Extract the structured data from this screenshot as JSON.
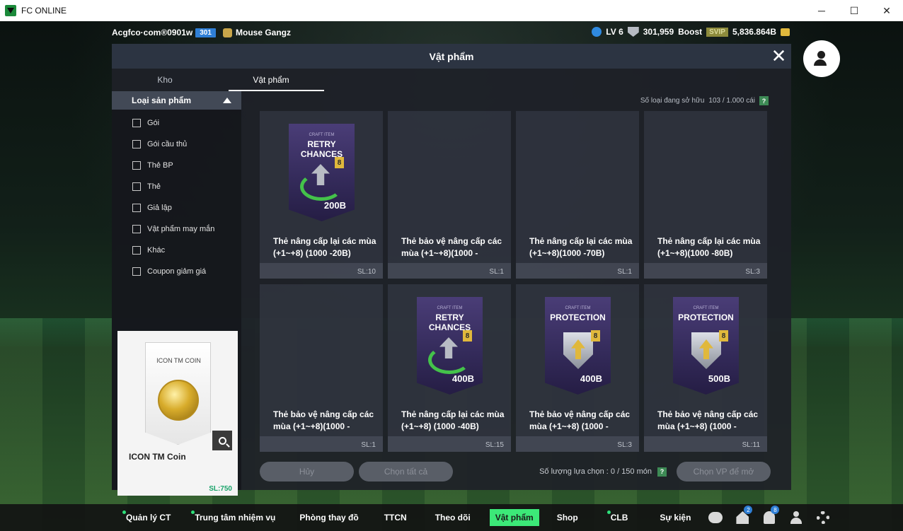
{
  "window": {
    "title": "FC ONLINE",
    "controls": [
      "─",
      "☐",
      "✕"
    ]
  },
  "topbar": {
    "account": "Acgfco·com®0901w",
    "account_badge": "301",
    "club": "Mouse Gangz",
    "level": "LV 6",
    "points": "301,959",
    "boost": "Boost",
    "svip": "SVIP",
    "bp": "5,836.864B"
  },
  "modal": {
    "title": "Vật phẩm",
    "close_icon": "✕",
    "tabs": [
      {
        "label": "Kho"
      },
      {
        "label": "Vật phẩm"
      }
    ],
    "filter": {
      "header": "Loại sản phẩm",
      "items": [
        {
          "label": "Gói"
        },
        {
          "label": "Gói cầu thủ"
        },
        {
          "label": "Thẻ BP"
        },
        {
          "label": "Thẻ"
        },
        {
          "label": "Giả lập"
        },
        {
          "label": "Vật phẩm may mắn"
        },
        {
          "label": "Khác"
        },
        {
          "label": "Coupon giảm giá"
        }
      ]
    },
    "preview": {
      "card_title": "ICON TM COIN",
      "name": "ICON TM Coin",
      "qty": "SL:750"
    },
    "owned_label": "Số loại đang sở hữu",
    "owned_value": "103 / 1.000 cái",
    "help": "?",
    "items": [
      {
        "name": "Thẻ nâng cấp lại các mùa (+1~+8) (1000 -20B)",
        "qty": "SL:10",
        "card": {
          "type": "retry",
          "craft": "CRAFT ITEM",
          "title": "RETRY CHANCES",
          "badge": "8",
          "price": "200B"
        }
      },
      {
        "name": "Thẻ bảo vệ nâng cấp các mùa (+1~+8)(1000 -",
        "qty": "SL:1"
      },
      {
        "name": "Thẻ nâng cấp lại các mùa (+1~+8)(1000 -70B)",
        "qty": "SL:1"
      },
      {
        "name": "Thẻ nâng cấp lại các mùa (+1~+8)(1000 -80B)",
        "qty": "SL:3"
      },
      {
        "name": "Thẻ bảo vệ nâng cấp các mùa (+1~+8)(1000 -",
        "qty": "SL:1"
      },
      {
        "name": "Thẻ nâng cấp lại các mùa (+1~+8) (1000 -40B)",
        "qty": "SL:15",
        "card": {
          "type": "retry",
          "craft": "CRAFT ITEM",
          "title": "RETRY CHANCES",
          "badge": "8",
          "price": "400B"
        }
      },
      {
        "name": "Thẻ bảo vệ nâng cấp các mùa (+1~+8) (1000 -",
        "qty": "SL:3",
        "card": {
          "type": "protection",
          "craft": "CRAFT ITEM",
          "title": "PROTECTION",
          "badge": "8",
          "price": "400B"
        }
      },
      {
        "name": "Thẻ bảo vệ nâng cấp các mùa (+1~+8) (1000 -",
        "qty": "SL:11",
        "card": {
          "type": "protection",
          "craft": "CRAFT ITEM",
          "title": "PROTECTION",
          "badge": "8",
          "price": "500B"
        }
      }
    ],
    "footer": {
      "cancel": "Hủy",
      "select_all": "Chọn tất cả",
      "select_count": "Số lượng lựa chọn : 0 / 150 món",
      "help": "?",
      "open": "Chọn VP để mở"
    }
  },
  "bottom_nav": [
    {
      "label": "Quản lý CT",
      "dot": true
    },
    {
      "label": "Trung tâm nhiệm vụ",
      "dot": true
    },
    {
      "label": "Phòng thay đồ",
      "dot": false
    },
    {
      "label": "TTCN",
      "dot": false
    },
    {
      "label": "Theo dõi",
      "dot": false
    },
    {
      "label": "Vật phẩm",
      "dot": false,
      "active": true
    },
    {
      "label": "Shop",
      "dot": false
    },
    {
      "label": "CLB",
      "dot": true
    },
    {
      "label": "Sự kiện",
      "dot": false
    }
  ],
  "nav_icons": {
    "home_badge": "2",
    "bell_badge": "8"
  },
  "colors": {
    "active_nav": "#3ce878",
    "accent_blue": "#2f7fd6",
    "qty_green": "#1aa36a"
  }
}
